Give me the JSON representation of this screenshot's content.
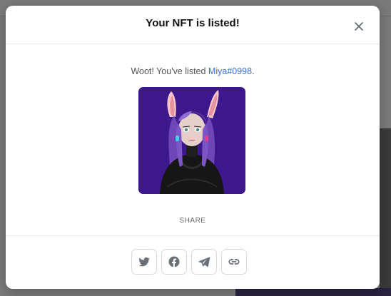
{
  "modal": {
    "title": "Your NFT is listed!",
    "close_icon": "close-icon",
    "message_prefix": "Woot! You've listed ",
    "nft_name": "Miya#0998",
    "message_suffix": ".",
    "image_alt": "NFT avatar: character with purple hair and bunny ears",
    "share_label": "SHARE",
    "share_buttons": [
      {
        "icon": "twitter-icon"
      },
      {
        "icon": "facebook-icon"
      },
      {
        "icon": "telegram-icon"
      },
      {
        "icon": "link-icon"
      }
    ]
  },
  "colors": {
    "accent_link": "#3b6fd8",
    "nft_background": "#3d178c",
    "icon_gray": "#6b6f78"
  }
}
